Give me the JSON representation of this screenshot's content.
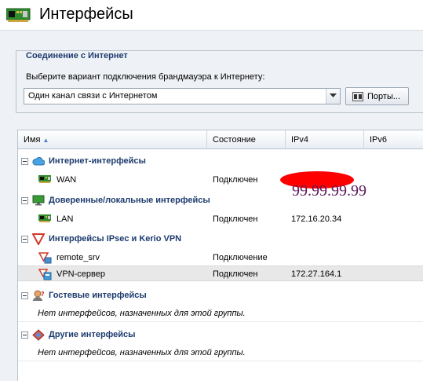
{
  "window": {
    "title": "Интерфейсы"
  },
  "connection": {
    "legend": "Соединение с Интернет",
    "prompt": "Выберите вариант подключения брандмауэра к Интернету:",
    "selected_option": "Один канал связи с Интернетом",
    "ports_button": "Порты..."
  },
  "table": {
    "columns": [
      "Имя",
      "Состояние",
      "IPv4",
      "IPv6"
    ],
    "groups": [
      {
        "name": "Интернет-интерфейсы",
        "icon": "cloud-icon",
        "items": [
          {
            "name": "WAN",
            "state": "Подключен",
            "ipv4": "",
            "icon": "network-card-icon"
          }
        ]
      },
      {
        "name": "Доверенные/локальные интерфейсы",
        "icon": "monitor-icon",
        "items": [
          {
            "name": "LAN",
            "state": "Подключен",
            "ipv4": "172.16.20.34",
            "icon": "network-card-icon"
          }
        ]
      },
      {
        "name": "Интерфейсы IPsec и Kerio VPN",
        "icon": "shield-icon",
        "items": [
          {
            "name": "remote_srv",
            "state": "Подключение",
            "ipv4": "",
            "icon": "vpn-tunnel-icon"
          },
          {
            "name": "VPN-сервер",
            "state": "Подключен",
            "ipv4": "172.27.164.1",
            "icon": "vpn-server-icon"
          }
        ]
      },
      {
        "name": "Гостевые интерфейсы",
        "icon": "guest-icon",
        "empty_text": "Нет интерфейсов, назначенных для этой группы."
      },
      {
        "name": "Другие интерфейсы",
        "icon": "diamond-icon",
        "empty_text": "Нет интерфейсов, назначенных для этой группы."
      }
    ]
  },
  "annotation": {
    "overlay_ip": "99.99.99.99",
    "redaction_color": "#ff0000"
  }
}
